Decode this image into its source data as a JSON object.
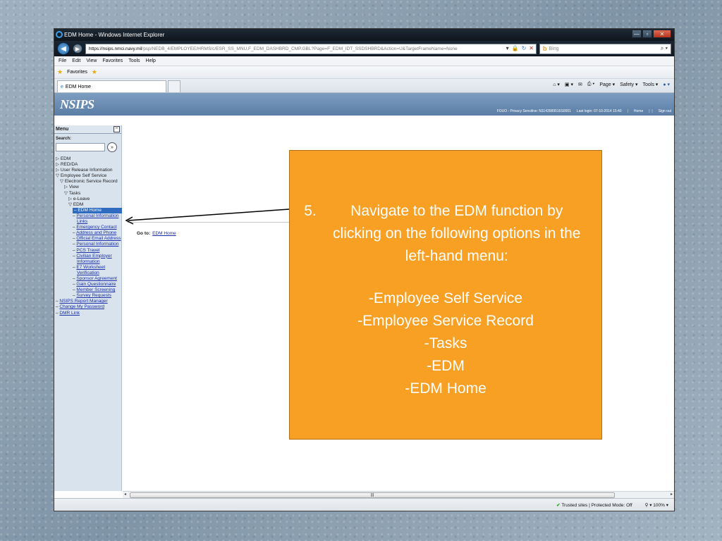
{
  "window": {
    "title": "EDM Home - Windows Internet Explorer",
    "url_host": "https://nsips.nmci.navy.mil",
    "url_path": "/psp/NEDB_4/EMPLOYEE/HRMS/c/ESR_SS_MNU.F_EDM_DASHBRD_CMP.GBL?Page=F_EDM_IDT_SSDSHBRD&Action=U&TargetFrameName=None",
    "search_placeholder": "Bing",
    "min_label": "—",
    "max_label": "▫",
    "close_label": "✕"
  },
  "menubar": [
    "File",
    "Edit",
    "View",
    "Favorites",
    "Tools",
    "Help"
  ],
  "favorites": {
    "label": "Favorites"
  },
  "tab": {
    "label": "EDM Home"
  },
  "command_bar": [
    "Page ▾",
    "Safety ▾",
    "Tools ▾"
  ],
  "site": {
    "logo": "NSIPS",
    "fouo": "FOUO - Privacy Sensitive: N1143589516S0001",
    "last_login": "Last login: 07-10-2014 15:40",
    "home": "Home",
    "sign_out": "Sign out"
  },
  "sidebar": {
    "title": "Menu",
    "search_label": "Search:",
    "tree": [
      {
        "indent": 0,
        "prefix": "▷ ",
        "label": "EDM",
        "link": false
      },
      {
        "indent": 0,
        "prefix": "▷ ",
        "label": "RED/DA",
        "link": false
      },
      {
        "indent": 0,
        "prefix": "▷ ",
        "label": "User Release Information",
        "link": false
      },
      {
        "indent": 0,
        "prefix": "▽ ",
        "label": "Employee Self Service",
        "link": false
      },
      {
        "indent": 1,
        "prefix": "▽ ",
        "label": "Electronic Service Record",
        "link": false
      },
      {
        "indent": 2,
        "prefix": "▷ ",
        "label": "View",
        "link": false
      },
      {
        "indent": 2,
        "prefix": "▽ ",
        "label": "Tasks",
        "link": false
      },
      {
        "indent": 3,
        "prefix": "▷ ",
        "label": "e-Leave",
        "link": false
      },
      {
        "indent": 3,
        "prefix": "▽ ",
        "label": "EDM",
        "link": false
      },
      {
        "indent": 4,
        "prefix": "",
        "label": "– EDM Home",
        "link": false,
        "selected": true
      },
      {
        "indent": 4,
        "prefix": "– ",
        "label": "Personal Information",
        "link": true
      },
      {
        "indent": 5,
        "prefix": "",
        "label": "Links",
        "link": true
      },
      {
        "indent": 4,
        "prefix": "– ",
        "label": "Emergency Contact",
        "link": true
      },
      {
        "indent": 4,
        "prefix": "– ",
        "label": "Address and Phone",
        "link": true
      },
      {
        "indent": 4,
        "prefix": "– ",
        "label": "Official Email Address",
        "link": true
      },
      {
        "indent": 4,
        "prefix": "– ",
        "label": "Personal Information",
        "link": true
      },
      {
        "indent": 4,
        "prefix": "– ",
        "label": "PCS Travel",
        "link": true
      },
      {
        "indent": 4,
        "prefix": "– ",
        "label": "Civilian Employer",
        "link": true
      },
      {
        "indent": 5,
        "prefix": "",
        "label": "Information",
        "link": true
      },
      {
        "indent": 4,
        "prefix": "– ",
        "label": "E7 Worksheet",
        "link": true
      },
      {
        "indent": 5,
        "prefix": "",
        "label": "Verification",
        "link": true
      },
      {
        "indent": 4,
        "prefix": "– ",
        "label": "Sponsor Agreement",
        "link": true
      },
      {
        "indent": 4,
        "prefix": "– ",
        "label": "Gain Questionnaire",
        "link": true
      },
      {
        "indent": 4,
        "prefix": "– ",
        "label": "Member Screening",
        "link": true
      },
      {
        "indent": 4,
        "prefix": "– ",
        "label": "Survey Requests",
        "link": true
      },
      {
        "indent": 0,
        "prefix": "– ",
        "label": "NSIPS Report Manager",
        "link": true
      },
      {
        "indent": 0,
        "prefix": "– ",
        "label": "Change My Password",
        "link": true
      },
      {
        "indent": 0,
        "prefix": "– ",
        "label": "DMR Link",
        "link": true
      }
    ]
  },
  "main": {
    "goto_label": "Go to:",
    "goto_link": "EDM Home"
  },
  "statusbar": {
    "zone": "Trusted sites | Protected Mode: Off",
    "zoom": "100%"
  },
  "callout": {
    "step_number": "5.",
    "step_text": "Navigate to the EDM function by clicking on the following options in the left-hand menu:",
    "items": [
      "-Employee Self Service",
      "-Employee Service Record",
      "-Tasks",
      "-EDM",
      "-EDM Home"
    ],
    "background": "#f7a023"
  }
}
